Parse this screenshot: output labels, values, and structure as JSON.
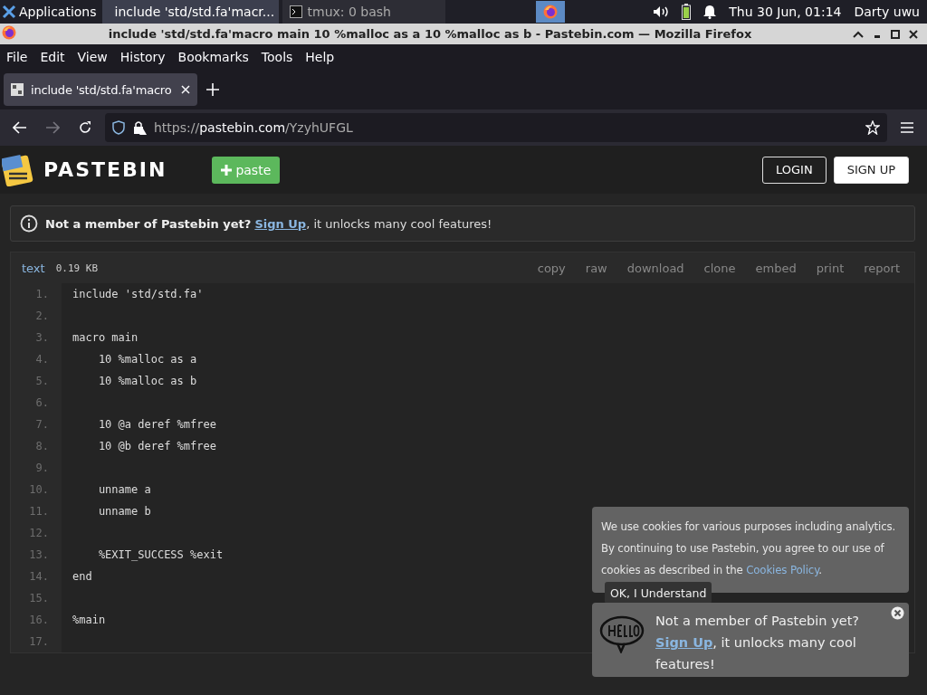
{
  "taskbar": {
    "apps_menu": "Applications",
    "tasks": [
      {
        "label": "include 'std/std.fa'macr...",
        "kind": "firefox",
        "selected": true
      },
      {
        "label": "tmux: 0 bash",
        "kind": "terminal",
        "selected": false
      }
    ],
    "clock": "Thu 30 Jun, 01:14",
    "user": "Darty uwu"
  },
  "window": {
    "title": "include 'std/std.fa'macro main 10 %malloc as a 10 %malloc as b - Pastebin.com — Mozilla Firefox"
  },
  "menu": [
    "File",
    "Edit",
    "View",
    "History",
    "Bookmarks",
    "Tools",
    "Help"
  ],
  "tabs": [
    {
      "label": "include 'std/std.fa'macro",
      "selected": true
    }
  ],
  "url": {
    "scheme": "https://",
    "host": "pastebin.com",
    "path": "/YzyhUFGL"
  },
  "site_header": {
    "logo": "PASTEBIN",
    "paste_button": "paste",
    "login": "LOGIN",
    "signup": "SIGN UP"
  },
  "notice": {
    "lead": "Not a member of Pastebin yet?",
    "link": "Sign Up",
    "rest": ", it unlocks many cool features!"
  },
  "paste": {
    "syntax": "text",
    "size": "0.19 KB",
    "actions": [
      "copy",
      "raw",
      "download",
      "clone",
      "embed",
      "print",
      "report"
    ],
    "lines": [
      {
        "number": "1.",
        "code": "include 'std/std.fa'"
      },
      {
        "number": "2."
      },
      {
        "number": "3.",
        "code": "macro main"
      },
      {
        "number": "4.",
        "code": "    10 %malloc as a"
      },
      {
        "number": "5.",
        "code": "    10 %malloc as b"
      },
      {
        "number": "6."
      },
      {
        "number": "7.",
        "code": "    10 @a deref %mfree"
      },
      {
        "number": "8.",
        "code": "    10 @b deref %mfree"
      },
      {
        "number": "9."
      },
      {
        "number": "10.",
        "code": "    unname a"
      },
      {
        "number": "11.",
        "code": "    unname b"
      },
      {
        "number": "12."
      },
      {
        "number": "13.",
        "code": "    %EXIT_SUCCESS %exit"
      },
      {
        "number": "14.",
        "code": "end"
      },
      {
        "number": "15."
      },
      {
        "number": "16.",
        "code": "%main"
      },
      {
        "number": "17."
      }
    ]
  },
  "cookie_banner": {
    "text": "We use cookies for various purposes including analytics. By continuing to use Pastebin, you agree to our use of cookies as described in the ",
    "link": "Cookies Policy",
    "end": ".",
    "button": "OK, I Understand"
  },
  "signup_popup": {
    "lead": "Not a member of Pastebin yet?",
    "link": "Sign Up",
    "rest": ", it unlocks many cool features!"
  }
}
